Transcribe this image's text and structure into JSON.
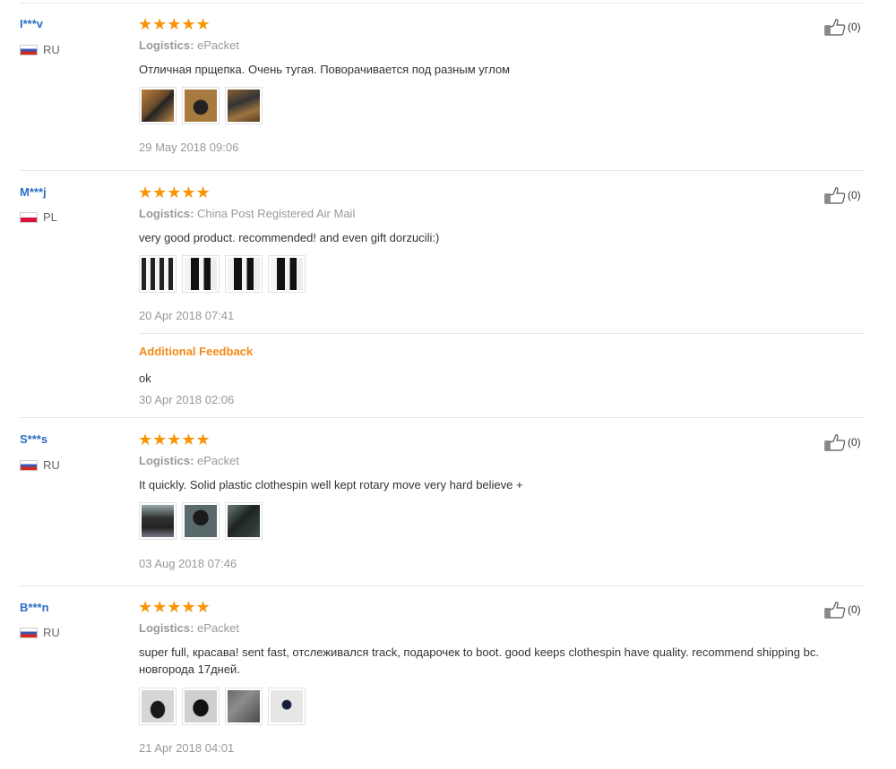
{
  "colors": {
    "star": "#f89406",
    "link": "#2a6ec3",
    "additional": "#f38a18",
    "muted": "#999999"
  },
  "reviews": [
    {
      "user": "I***v",
      "country": "RU",
      "flag": "ru",
      "rating": 5,
      "stars": "★★★★★",
      "logistics_label": "Logistics:",
      "logistics": "ePacket",
      "comment": "Отличная прщепка. Очень тугая. Поворачивается под разным углом",
      "photos": 3,
      "date": "29 May 2018 09:06",
      "helpful": "(0)"
    },
    {
      "user": "M***j",
      "country": "PL",
      "flag": "pl",
      "rating": 5,
      "stars": "★★★★★",
      "logistics_label": "Logistics:",
      "logistics": "China Post Registered Air Mail",
      "comment": "very good product. recommended! and even gift dorzucili:)",
      "photos": 4,
      "date": "20 Apr 2018 07:41",
      "helpful": "(0)",
      "additional_feedback": {
        "title": "Additional Feedback",
        "text": "ok",
        "date": "30 Apr 2018 02:06"
      }
    },
    {
      "user": "S***s",
      "country": "RU",
      "flag": "ru",
      "rating": 5,
      "stars": "★★★★★",
      "logistics_label": "Logistics:",
      "logistics": "ePacket",
      "comment": "It quickly. Solid plastic clothespin well kept rotary move very hard believe +",
      "photos": 3,
      "date": "03 Aug 2018 07:46",
      "helpful": "(0)"
    },
    {
      "user": "B***n",
      "country": "RU",
      "flag": "ru",
      "rating": 5,
      "stars": "★★★★★",
      "logistics_label": "Logistics:",
      "logistics": "ePacket",
      "comment": "super full, красава! sent fast, отслеживался track, подарочек to boot. good keeps clothespin have quality. recommend shipping bc. новгорода 17дней.",
      "photos": 4,
      "date": "21 Apr 2018 04:01",
      "helpful": "(0)"
    }
  ]
}
